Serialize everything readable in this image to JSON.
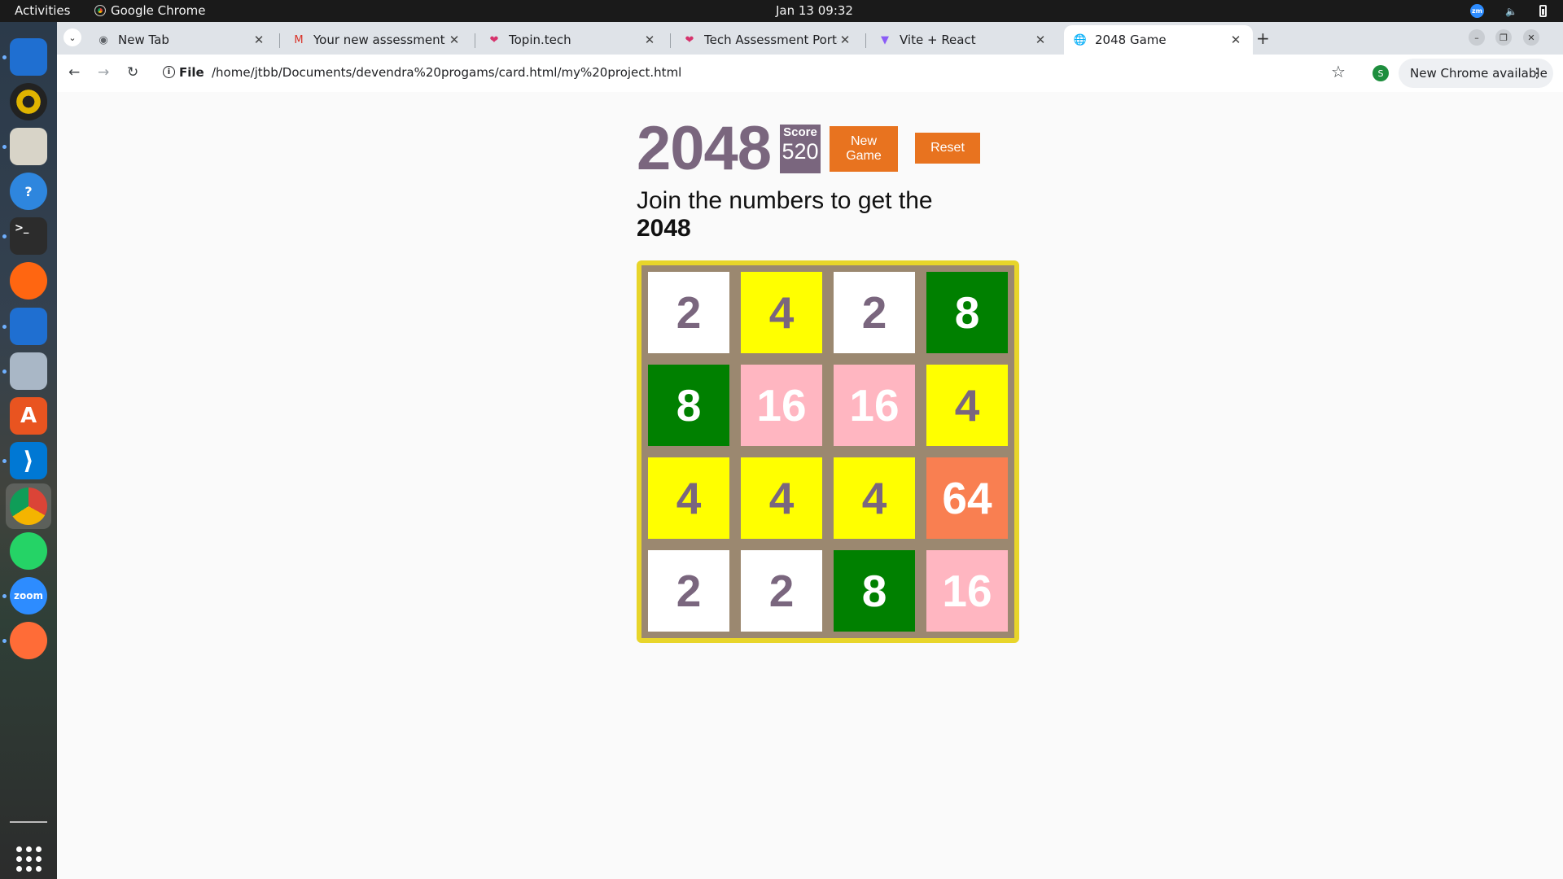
{
  "topbar": {
    "activities": "Activities",
    "app_name": "Google Chrome",
    "clock": "Jan 13  09:32",
    "zoom_tray": "zm"
  },
  "dock": {
    "items": [
      {
        "name": "thunderbird-icon",
        "color": "#1f6fd1"
      },
      {
        "name": "rhythmbox-icon",
        "color": "#e0b400"
      },
      {
        "name": "archive-icon",
        "color": "#d8d4c8"
      },
      {
        "name": "help-icon",
        "color": "#2e86de"
      },
      {
        "name": "terminal-icon",
        "color": "#2c2c2c"
      },
      {
        "name": "firefox-icon",
        "color": "#ff6611"
      },
      {
        "name": "writer-icon",
        "color": "#1f6fd1"
      },
      {
        "name": "files-icon",
        "color": "#a9b7c6"
      },
      {
        "name": "app-center-icon",
        "color": "#e95420"
      },
      {
        "name": "vscode-icon",
        "color": "#0078d4"
      },
      {
        "name": "chrome-icon",
        "color": "#4285f4"
      },
      {
        "name": "whatsapp-icon",
        "color": "#25d366"
      },
      {
        "name": "zoom-icon",
        "color": "#2d8cff"
      },
      {
        "name": "postman-icon",
        "color": "#ff6c37"
      }
    ],
    "zoom_label": "zoom"
  },
  "tabs": [
    {
      "title": "New Tab",
      "favicon": "chrome-icon",
      "active": false
    },
    {
      "title": "Your new assessment is",
      "favicon": "gmail-icon",
      "active": false
    },
    {
      "title": "Topin.tech",
      "favicon": "topin-icon",
      "active": false
    },
    {
      "title": "Tech Assessment Portal",
      "favicon": "topin-icon",
      "active": false
    },
    {
      "title": "Vite + React",
      "favicon": "vite-icon",
      "active": false
    },
    {
      "title": "2048 Game",
      "favicon": "globe-icon",
      "active": true
    }
  ],
  "toolbar": {
    "scheme": "File",
    "url": "/home/jtbb/Documents/devendra%20progams/card.html/my%20project.html",
    "profile_initial": "S",
    "update_label": "New Chrome available"
  },
  "game": {
    "title": "2048",
    "score_label": "Score",
    "score": "520",
    "new_game_label": "New Game",
    "reset_label": "Reset",
    "subtitle_line1": "Join the numbers to get the",
    "subtitle_line2": "2048",
    "board": [
      [
        2,
        4,
        2,
        8
      ],
      [
        8,
        16,
        16,
        4
      ],
      [
        4,
        4,
        4,
        64
      ],
      [
        2,
        2,
        8,
        16
      ]
    ],
    "tile_colors": {
      "2": {
        "bg": "#ffffff",
        "fg": "#7a667e"
      },
      "4": {
        "bg": "#ffff00",
        "fg": "#7a667e"
      },
      "8": {
        "bg": "#008000",
        "fg": "#ffffff"
      },
      "16": {
        "bg": "#ffb6c1",
        "fg": "#ffffff"
      },
      "64": {
        "bg": "#f97f51",
        "fg": "#ffffff"
      }
    }
  }
}
